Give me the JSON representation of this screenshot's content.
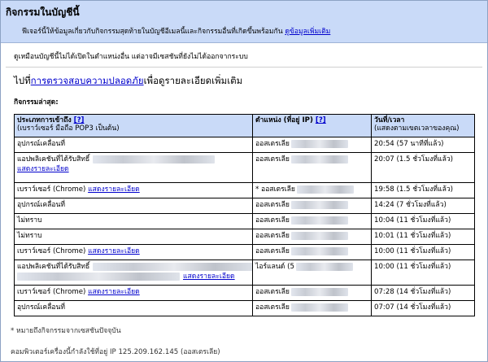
{
  "header": {
    "title": "กิจกรรมในบัญชีนี้",
    "description": "ฟีเจอร์นี้ให้ข้อมูลเกี่ยวกับกิจกรรมสุดท้ายในบัญชีอีเมลนี้และกิจกรรมอื่นที่เกิดขึ้นพร้อมกัน",
    "more_info_link": "ดูข้อมูลเพิ่มเติม"
  },
  "sessions_note": "ดูเหมือนบัญชีนี้ไม่ได้เปิดในตำแหน่งอื่น แต่อาจมีเซสชันที่ยังไม่ได้ออกจากระบบ",
  "security": {
    "prefix": "ไปที่",
    "link": "การตรวจสอบความปลอดภัย",
    "suffix": "เพื่อดูรายละเอียดเพิ่มเติม"
  },
  "recent_label": "กิจกรรมล่าสุด:",
  "table": {
    "headers": {
      "type": "ประเภทการเข้าถึง",
      "type_help": "[?]",
      "type_sub": "(เบราว์เซอร์ มือถือ POP3 เป็นต้น)",
      "location": "ตำแหน่ง (ที่อยู่ IP)",
      "location_help": "[?]",
      "time": "วันที่/เวลา",
      "time_sub": "(แสดงตามเขตเวลาของคุณ)"
    },
    "details_link": "แสดงรายละเอียด",
    "rows": [
      {
        "type": "อุปกรณ์เคลื่อนที่",
        "link": "",
        "location": "ออสเตรเลีย",
        "time": "20:54 (57 นาทีที่แล้ว)"
      },
      {
        "type": "แอปพลิเคชันที่ได้รับสิทธิ์",
        "link": "แสดงรายละเอียด",
        "location": "ออสเตรเลีย",
        "time": "20:07 (1.5 ชั่วโมงที่แล้ว)"
      },
      {
        "type": "เบราว์เซอร์ (Chrome)",
        "link": "แสดงรายละเอียด",
        "location": "* ออสเตรเลีย",
        "time": "19:58 (1.5 ชั่วโมงที่แล้ว)"
      },
      {
        "type": "อุปกรณ์เคลื่อนที่",
        "link": "",
        "location": "ออสเตรเลีย",
        "time": "14:24 (7 ชั่วโมงที่แล้ว)"
      },
      {
        "type": "ไม่ทราบ",
        "link": "",
        "location": "ออสเตรเลีย",
        "time": "10:04 (11 ชั่วโมงที่แล้ว)"
      },
      {
        "type": "ไม่ทราบ",
        "link": "",
        "location": "ออสเตรเลีย",
        "time": "10:01 (11 ชั่วโมงที่แล้ว)"
      },
      {
        "type": "เบราว์เซอร์ (Chrome)",
        "link": "แสดงรายละเอียด",
        "location": "ออสเตรเลีย",
        "time": "10:00 (11 ชั่วโมงที่แล้ว)"
      },
      {
        "type": "แอปพลิเคชันที่ได้รับสิทธิ์",
        "link": "แสดงรายละเอียด",
        "location": "ไอร์แลนด์ (5",
        "time": "10:00 (11 ชั่วโมงที่แล้ว)"
      },
      {
        "type": "เบราว์เซอร์ (Chrome)",
        "link": "แสดงรายละเอียด",
        "location": "ออสเตรเลีย",
        "time": "07:28 (14 ชั่วโมงที่แล้ว)"
      },
      {
        "type": "อุปกรณ์เคลื่อนที่",
        "link": "",
        "location": "ออสเตรเลีย",
        "time": "07:07 (14 ชั่วโมงที่แล้ว)"
      }
    ]
  },
  "footer": {
    "note": "* หมายถึงกิจกรรมจากเซสชันปัจจุบัน",
    "ip_line": "คอมพิวเตอร์เครื่องนี้กำลังใช้ที่อยู่ IP 125.209.162.145 (ออสเตรเลีย)"
  }
}
